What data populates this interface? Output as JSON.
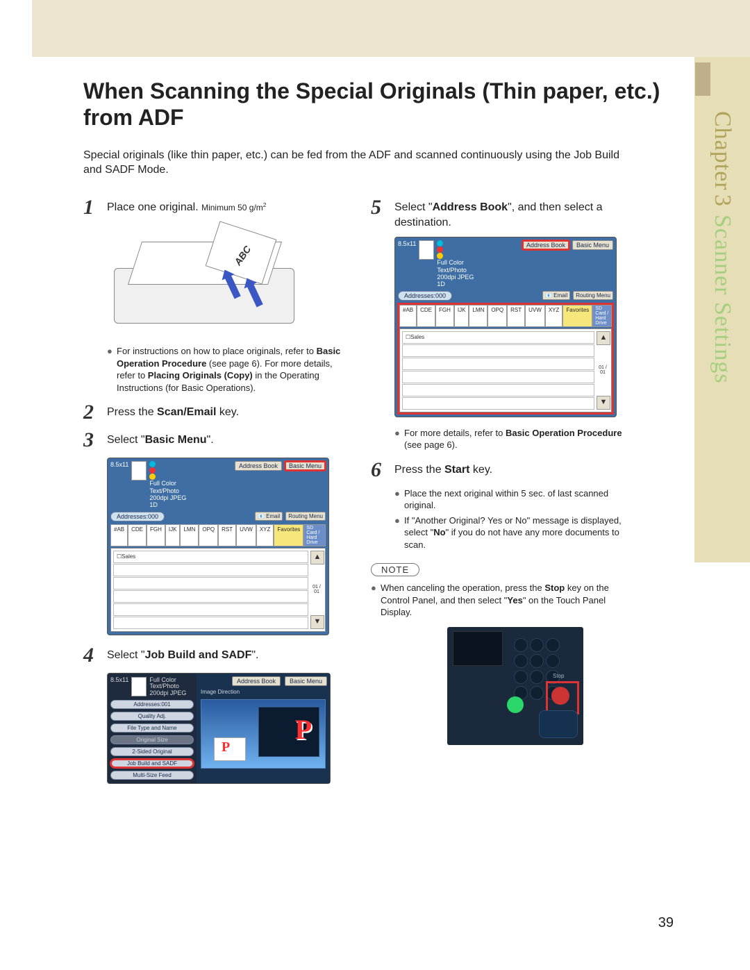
{
  "page_number": "39",
  "side": {
    "chapter_word": "Chapter",
    "chapter_num": "3",
    "section": "Scanner Settings"
  },
  "title": "When Scanning the Special Originals (Thin paper, etc.) from ADF",
  "intro": "Special originals (like thin paper, etc.) can be fed from the ADF and scanned continuously using the Job Build and SADF Mode.",
  "steps": {
    "s1": {
      "num": "1",
      "text_a": "Place one original. ",
      "text_min": "Minimum 50 g/m",
      "abc": "ABC",
      "bullet_a_pre": "For instructions on how to place originals, refer to ",
      "bullet_a_bold": "Basic Operation Procedure",
      "bullet_a_mid": " (see page 6). For more details, refer to ",
      "bullet_a_bold2": "Placing Originals (Copy)",
      "bullet_a_post": " in the Operating Instructions (for Basic Operations)."
    },
    "s2": {
      "num": "2",
      "pre": "Press the ",
      "bold": "Scan/Email",
      "post": " key."
    },
    "s3": {
      "num": "3",
      "pre": "Select \"",
      "bold": "Basic Menu",
      "post": "\"."
    },
    "s4": {
      "num": "4",
      "pre": "Select \"",
      "bold": "Job Build and SADF",
      "post": "\"."
    },
    "s5": {
      "num": "5",
      "pre": "Select \"",
      "bold": "Address Book",
      "post": "\", and then select a destination.",
      "bullet_pre": "For more details, refer to ",
      "bullet_bold": "Basic Operation Procedure",
      "bullet_post": " (see page 6)."
    },
    "s6": {
      "num": "6",
      "pre": "Press the ",
      "bold": "Start",
      "post": " key.",
      "b1": "Place the next original within 5 sec. of last scanned original.",
      "b2_pre": "If \"Another Original? Yes or No\" message is displayed, select \"",
      "b2_bold": "No",
      "b2_post": "\" if you do not have any more documents to scan."
    }
  },
  "note": {
    "label": "NOTE",
    "text_pre": "When canceling the operation, press the ",
    "text_b1": "Stop",
    "text_mid": " key on the Control Panel, and then select \"",
    "text_b2": "Yes",
    "text_post": "\" on the Touch Panel Display.",
    "stop_label": "Stop"
  },
  "screens": {
    "common": {
      "size": "8.5x11",
      "full_color": "Full Color",
      "text_photo": "Text/Photo",
      "res": "200dpi JPEG",
      "id_line": "1D",
      "addr0": "Addresses:000",
      "addr1": "Addresses:001",
      "address_book": "Address Book",
      "basic_menu": "Basic Menu",
      "email": "Email",
      "routing": "Routing Menu",
      "fav": "Favorites",
      "sd": "SD Card / Hard Drive",
      "tabs": [
        "#AB",
        "CDE",
        "FGH",
        "IJK",
        "LMN",
        "OPQ",
        "RST",
        "UVW",
        "XYZ"
      ],
      "row1": "Sales",
      "scroll_mid": "01 / 01"
    },
    "s4menu": {
      "image_dir": "Image Direction",
      "items": [
        "Quality Adj.",
        "File Type and Name",
        "Original Size",
        "2-Sided Original",
        "Job Build and SADF",
        "Multi-Size Feed"
      ]
    }
  }
}
